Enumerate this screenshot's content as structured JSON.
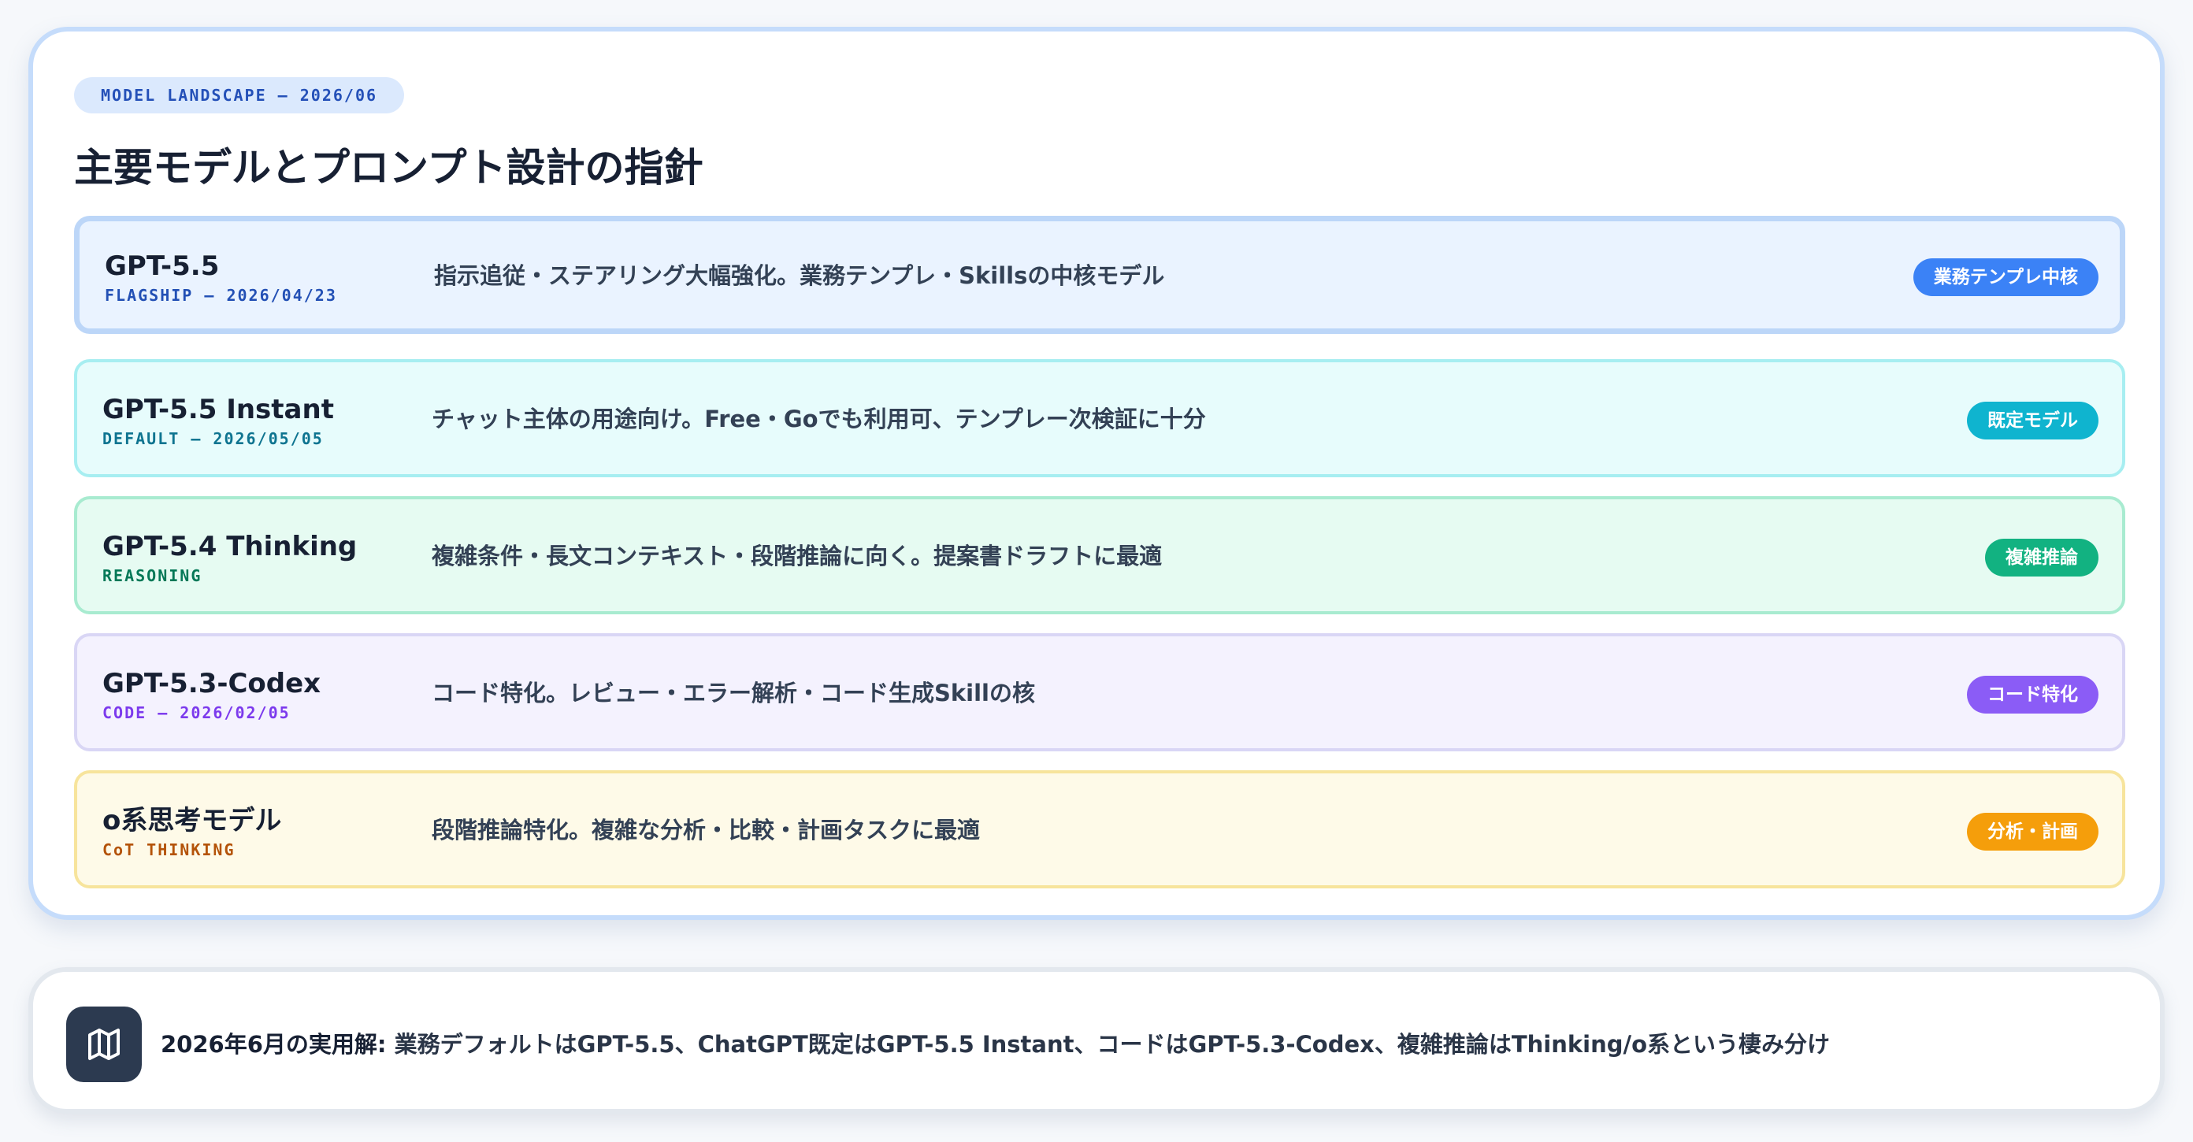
{
  "header": {
    "eyebrow": "MODEL LANDSCAPE — 2026/06",
    "title": "主要モデルとプロンプト設計の指針"
  },
  "models": [
    {
      "name": "GPT-5.5",
      "meta": "FLAGSHIP — 2026/04/23",
      "description": "指示追従・ステアリング大幅強化。業務テンプレ・Skillsの中核モデル",
      "badge": "業務テンプレ中核",
      "accent": "#3b82f6",
      "meta_color": "#2350b5",
      "bg": "#eaf3ff",
      "border": "#bcd6f8"
    },
    {
      "name": "GPT-5.5 Instant",
      "meta": "DEFAULT — 2026/05/05",
      "description": "チャット主体の用途向け。Free・Goでも利用可、テンプレー次検証に十分",
      "badge": "既定モデル",
      "accent": "#0fb4cf",
      "meta_color": "#0e7490",
      "bg": "#e7fcfc",
      "border": "#a7eef1"
    },
    {
      "name": "GPT-5.4 Thinking",
      "meta": "REASONING",
      "description": "複雑条件・長文コンテキスト・段階推論に向く。提案書ドラフトに最適",
      "badge": "複雑推論",
      "accent": "#12b281",
      "meta_color": "#047857",
      "bg": "#e6fbf2",
      "border": "#a8ebd0"
    },
    {
      "name": "GPT-5.3-Codex",
      "meta": "CODE — 2026/02/05",
      "description": "コード特化。レビュー・エラー解析・コード生成Skillの核",
      "badge": "コード特化",
      "accent": "#8b5cf6",
      "meta_color": "#7c3aed",
      "bg": "#f4f2fe",
      "border": "#d9d6f5"
    },
    {
      "name": "o系思考モデル",
      "meta": "CoT THINKING",
      "description": "段階推論特化。複雑な分析・比較・計画タスクに最適",
      "badge": "分析・計画",
      "accent": "#f59e0b",
      "meta_color": "#b45309",
      "bg": "#fefae8",
      "border": "#f7e49c"
    }
  ],
  "footer": {
    "icon": "map-icon",
    "lead": "2026年6月の実用解:",
    "body": " 業務デフォルトはGPT-5.5、ChatGPT既定はGPT-5.5 Instant、コードはGPT-5.3-Codex、複雑推論はThinking/o系という棲み分け"
  }
}
